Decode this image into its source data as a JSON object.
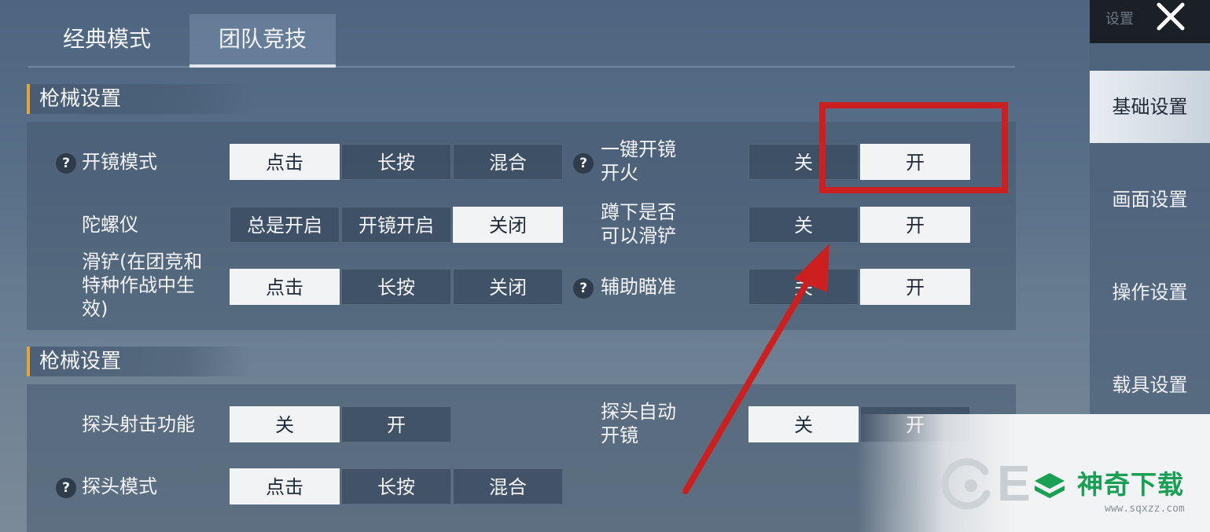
{
  "tabs": [
    {
      "label": "经典模式",
      "selected": false
    },
    {
      "label": "团队竞技",
      "selected": true
    }
  ],
  "sections": [
    {
      "title": "枪械设置"
    },
    {
      "title": "枪械设置"
    }
  ],
  "settings": {
    "scope_mode": {
      "label": "开镜模式",
      "options": [
        "点击",
        "长按",
        "混合"
      ],
      "selected": "点击"
    },
    "gyro": {
      "label": "陀螺仪",
      "options": [
        "总是开启",
        "开镜开启",
        "关闭"
      ],
      "selected": "关闭"
    },
    "slide": {
      "label_lines": [
        "滑铲(在团竞和",
        "特种作战中生",
        "效)"
      ],
      "options": [
        "点击",
        "长按",
        "关闭"
      ],
      "selected": "点击"
    },
    "one_key_scope_fire": {
      "label_lines": [
        "一键开镜",
        "开火"
      ],
      "options": [
        "关",
        "开"
      ],
      "selected": "开"
    },
    "crouch_slide": {
      "label_lines": [
        "蹲下是否",
        "可以滑铲"
      ],
      "options": [
        "关",
        "开"
      ],
      "selected": "开"
    },
    "aim_assist": {
      "label": "辅助瞄准",
      "options": [
        "关",
        "开"
      ],
      "selected": "开"
    },
    "peek_fire": {
      "label": "探头射击功能",
      "options": [
        "关",
        "开"
      ],
      "selected": "关"
    },
    "peek_auto_scope": {
      "label_lines": [
        "探头自动",
        "开镜"
      ],
      "options": [
        "关",
        "开"
      ],
      "selected": "关"
    },
    "peek_mode": {
      "label": "探头模式",
      "options": [
        "点击",
        "长按",
        "混合"
      ],
      "selected": "点击"
    }
  },
  "help_glyph": "?",
  "sidebar": {
    "top_label": "设置",
    "items": [
      {
        "label": "基础设置",
        "active": true
      },
      {
        "label": "画面设置",
        "active": false
      },
      {
        "label": "操作设置",
        "active": false
      },
      {
        "label": "载具设置",
        "active": false
      }
    ]
  },
  "watermark": {
    "brand": "神奇下载",
    "url": "www.sqxzz.com",
    "partial_letter": "E"
  },
  "colors": {
    "accent_bar": "#e1a637",
    "selected_bg": "#f1f3f5",
    "annotation_red": "#cc2020",
    "brand_green": "#19a055"
  },
  "icons": {
    "close": "close-icon",
    "help": "help-icon",
    "arrow": "annotation-arrow",
    "highlight": "annotation-box"
  }
}
